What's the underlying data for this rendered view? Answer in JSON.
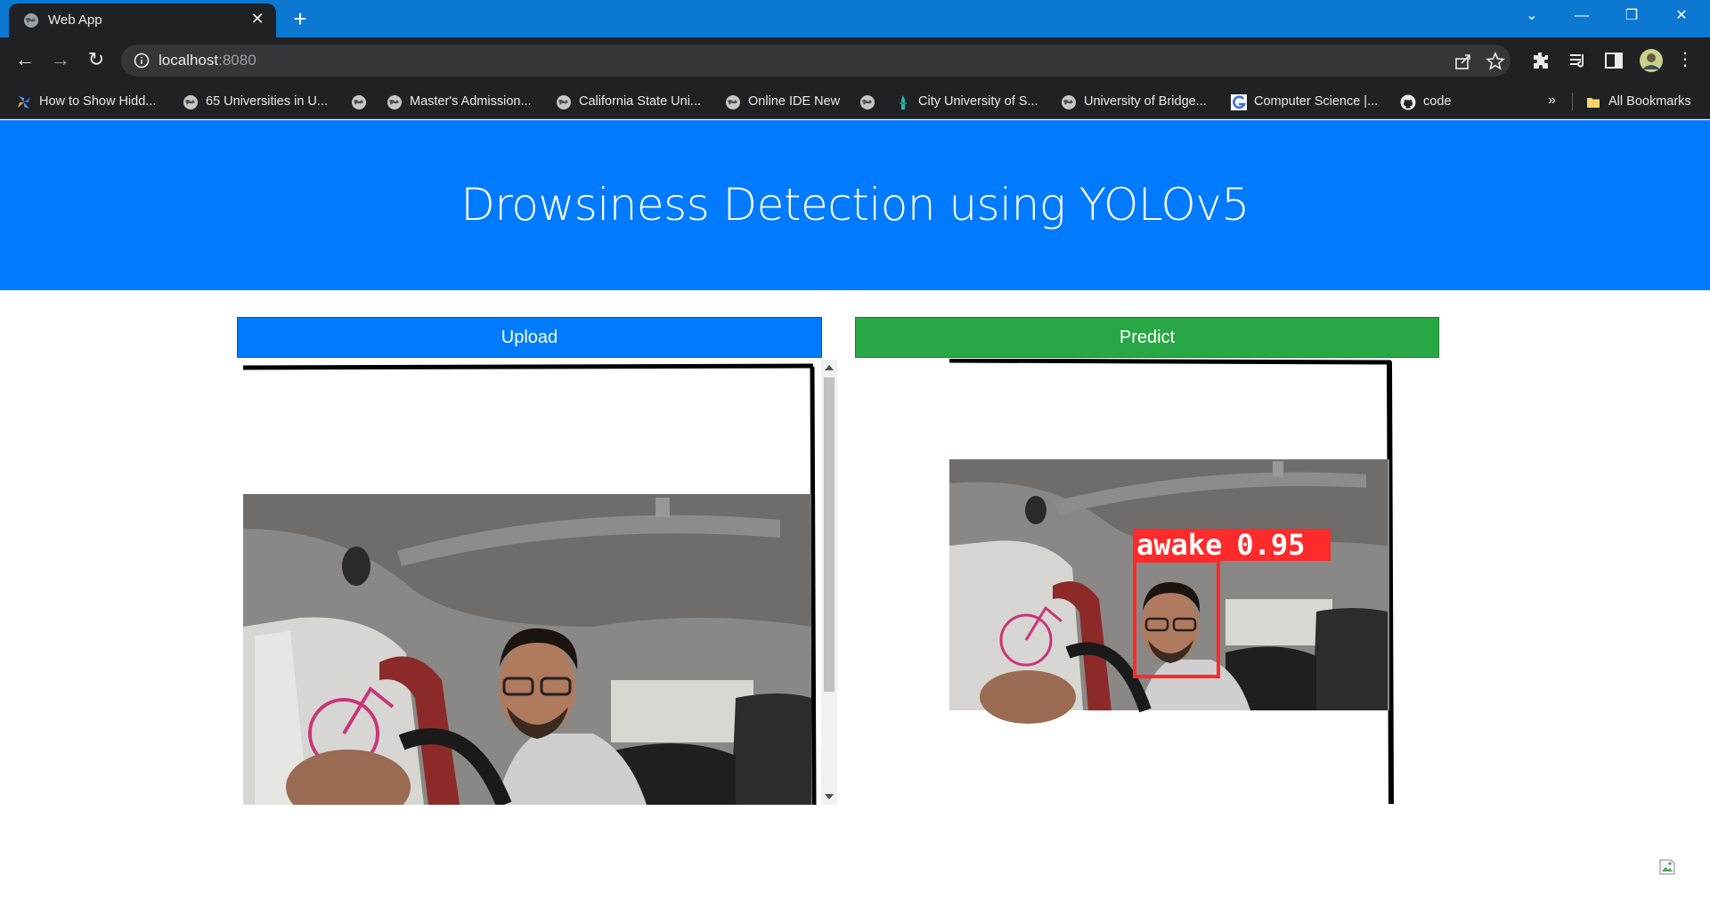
{
  "browser": {
    "tab_title": "Web App",
    "url_host": "localhost",
    "url_port": ":8080",
    "bookmarks": [
      {
        "label": "How to Show Hidd...",
        "icon": "pinwheel-icon"
      },
      {
        "label": "65 Universities in U...",
        "icon": "globe-icon"
      },
      {
        "label": "Master's Admission...",
        "icon": "globe-icon"
      },
      {
        "label": "California State Uni...",
        "icon": "globe-icon"
      },
      {
        "label": "Online IDE New",
        "icon": "globe-icon"
      },
      {
        "label": "City University of S...",
        "icon": "tower-icon"
      },
      {
        "label": "University of Bridge...",
        "icon": "globe-icon"
      },
      {
        "label": "Computer Science |...",
        "icon": "g-logo-icon"
      },
      {
        "label": "code",
        "icon": "github-icon"
      }
    ],
    "overflow_label": "»",
    "all_bookmarks_label": "All Bookmarks"
  },
  "page": {
    "title": "Drowsiness Detection using YOLOv5",
    "upload_label": "Upload",
    "predict_label": "Predict",
    "detection": {
      "label": "awake",
      "score": "0.95",
      "box_color": "#ff2a2a"
    }
  },
  "colors": {
    "header_bg": "#007bff",
    "upload_bg": "#007bff",
    "predict_bg": "#28a745",
    "titlebar_bg": "#0b78d1"
  }
}
